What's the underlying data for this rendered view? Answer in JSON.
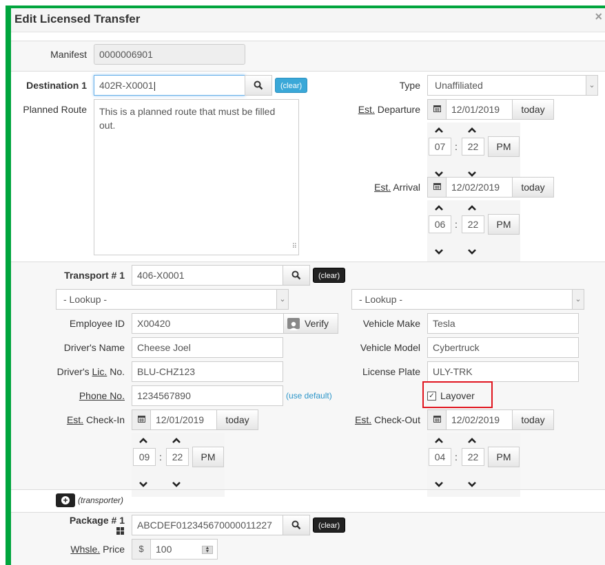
{
  "modal": {
    "title": "Edit Licensed Transfer",
    "close_glyph": "×"
  },
  "manifest": {
    "label": "Manifest",
    "value": "0000006901"
  },
  "destination": {
    "label": "Destination 1",
    "value": "402R-X0001",
    "clear_label": "(clear)",
    "planned_route_label": "Planned Route",
    "planned_route_value": "This is a planned route that must be filled out.",
    "type_label": "Type",
    "type_value": "Unaffiliated",
    "departure": {
      "label_prefix": "Est.",
      "label_suffix": " Departure",
      "date": "12/01/2019",
      "today_label": "today",
      "hour": "07",
      "minute": "22",
      "ampm": "PM"
    },
    "arrival": {
      "label_prefix": "Est.",
      "label_suffix": " Arrival",
      "date": "12/02/2019",
      "today_label": "today",
      "hour": "06",
      "minute": "22",
      "ampm": "PM"
    }
  },
  "transport": {
    "label": "Transport # 1",
    "value": "406-X0001",
    "clear_label": "(clear)",
    "lookup_left": "- Lookup -",
    "lookup_right": "- Lookup -",
    "employee_id_label": "Employee ID",
    "employee_id_value": "X00420",
    "verify_label": "Verify",
    "drivers_name_label": "Driver's Name",
    "drivers_name_value": "Cheese Joel",
    "drivers_lic_prefix": "Driver's ",
    "drivers_lic_abbr": "Lic.",
    "drivers_lic_suffix": " No.",
    "drivers_lic_value": "BLU-CHZ123",
    "phone_label": "Phone No.",
    "phone_value": "1234567890",
    "use_default_label": "(use default)",
    "vehicle_make_label": "Vehicle Make",
    "vehicle_make_value": "Tesla",
    "vehicle_model_label": "Vehicle Model",
    "vehicle_model_value": "Cybertruck",
    "license_plate_label": "License Plate",
    "license_plate_value": "ULY-TRK",
    "layover_label": "Layover",
    "layover_checked": true,
    "check_in": {
      "label_prefix": "Est.",
      "label_suffix": " Check-In",
      "date": "12/01/2019",
      "today_label": "today",
      "hour": "09",
      "minute": "22",
      "ampm": "PM"
    },
    "check_out": {
      "label_prefix": "Est.",
      "label_suffix": " Check-Out",
      "date": "12/02/2019",
      "today_label": "today",
      "hour": "04",
      "minute": "22",
      "ampm": "PM"
    },
    "add_transporter_label": "(transporter)"
  },
  "package": {
    "label": "Package # 1",
    "value": "ABCDEF012345670000011227",
    "clear_label": "(clear)",
    "price_label_abbr": "Whsle.",
    "price_label_suffix": " Price",
    "currency": "$",
    "price_value": "100"
  },
  "icons": {
    "search": "search-icon",
    "calendar": "calendar-icon",
    "person": "person-icon",
    "chevron_up": "chevron-up-icon",
    "chevron_down": "chevron-down-icon",
    "plus": "plus-circle-icon",
    "barcode": "barcode-icon"
  },
  "colors": {
    "frame": "#00a53d",
    "info_badge": "#3aa8d8",
    "highlight": "#e0141e"
  }
}
